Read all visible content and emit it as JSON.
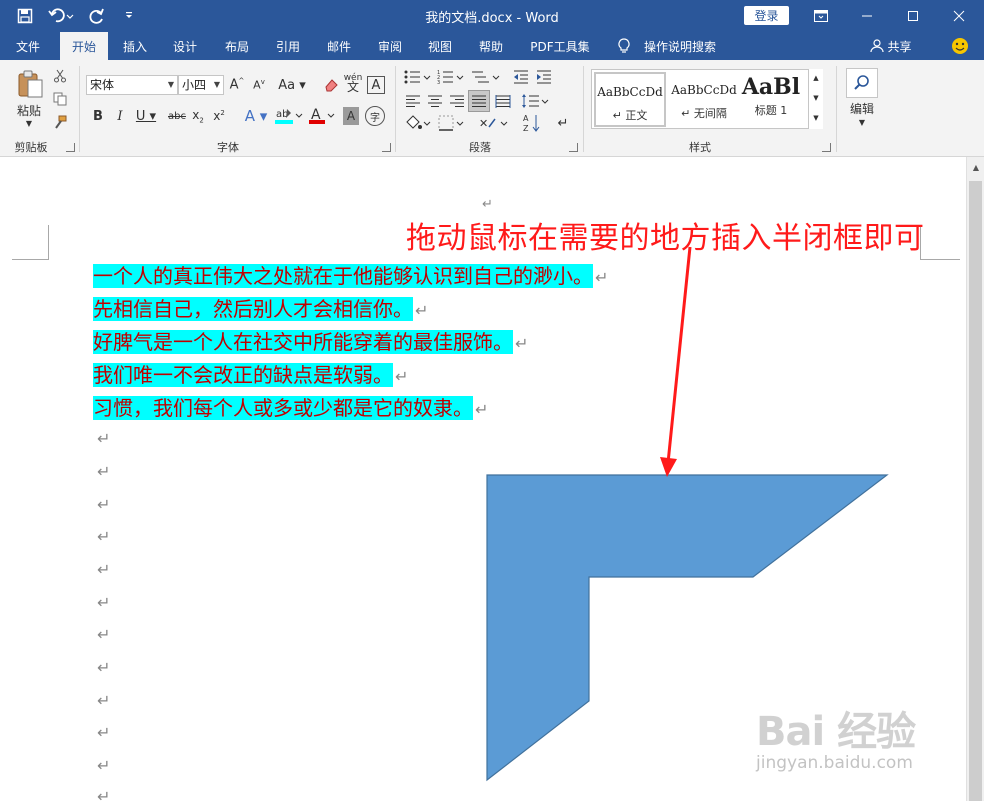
{
  "titlebar": {
    "title": "我的文档.docx  -  Word",
    "login_label": "登录",
    "bg_color": "#2b579a"
  },
  "tabs": [
    {
      "label": "文件"
    },
    {
      "label": "开始"
    },
    {
      "label": "插入"
    },
    {
      "label": "设计"
    },
    {
      "label": "布局"
    },
    {
      "label": "引用"
    },
    {
      "label": "邮件"
    },
    {
      "label": "审阅"
    },
    {
      "label": "视图"
    },
    {
      "label": "帮助"
    },
    {
      "label": "PDF工具集"
    },
    {
      "label": "操作说明搜索"
    }
  ],
  "share_label": "共享",
  "ribbon": {
    "clipboard": {
      "paste_label": "粘贴",
      "group_label": "剪贴板"
    },
    "font": {
      "font_name": "宋体",
      "font_size": "小四",
      "group_label": "字体",
      "phonetic": "wén"
    },
    "paragraph": {
      "group_label": "段落"
    },
    "styles": {
      "group_label": "样式",
      "items": [
        {
          "sample": "AaBbCcDd",
          "name": "↵ 正文"
        },
        {
          "sample": "AaBbCcDd",
          "name": "↵ 无间隔"
        },
        {
          "sample": "AaBl",
          "name": "标题 1"
        }
      ]
    },
    "editing": {
      "group_label": "编辑"
    }
  },
  "document": {
    "lines": [
      "一个人的真正伟大之处就在于他能够认识到自己的渺小。",
      "先相信自己，然后别人才会相信你。",
      "好脾气是一个人在社交中所能穿着的最佳服饰。",
      "我们唯一不会改正的缺点是软弱。",
      "习惯，我们每个人或多或少都是它的奴隶。"
    ],
    "paragraph_mark": "↵",
    "highlight_color": "#00ffff",
    "text_color": "#c00000"
  },
  "annotation": {
    "text": "拖动鼠标在需要的地方插入半闭框即可",
    "color": "#ff1a1a"
  },
  "shape": {
    "type": "half-frame",
    "fill": "#5b9bd5",
    "stroke": "#41719c"
  },
  "watermark": {
    "main": "Bai 经验",
    "sub": "jingyan.baidu.com"
  }
}
